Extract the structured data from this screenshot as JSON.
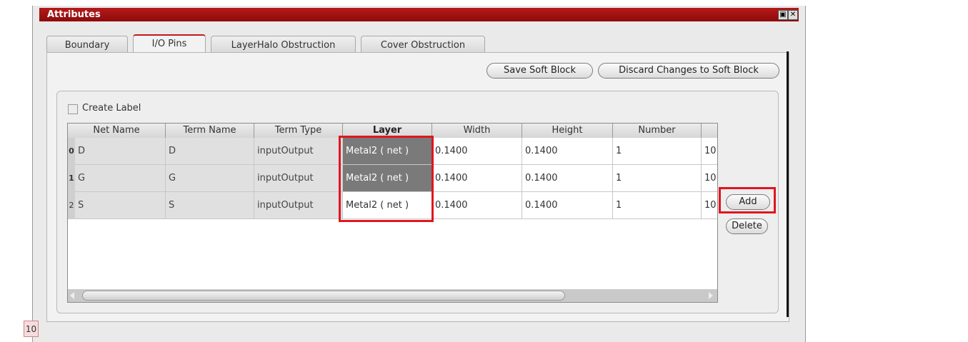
{
  "window": {
    "title": "Attributes",
    "restore_icon": "restore-icon",
    "close_icon": "close-icon"
  },
  "tabs": [
    {
      "label": "Boundary",
      "active": false
    },
    {
      "label": "I/O Pins",
      "active": true
    },
    {
      "label": "LayerHalo Obstruction",
      "active": false
    },
    {
      "label": "Cover Obstruction",
      "active": false
    }
  ],
  "actions": {
    "save": "Save Soft Block",
    "discard": "Discard Changes to Soft Block"
  },
  "create_label": {
    "label": "Create Label",
    "checked": false
  },
  "table": {
    "columns": [
      "Net Name",
      "Term Name",
      "Term Type",
      "Layer",
      "Width",
      "Height",
      "Number",
      ""
    ],
    "rows": [
      {
        "index": "0",
        "net": "D",
        "term": "D",
        "type": "inputOutput",
        "layer": "Metal2 ( net )",
        "width": "0.1400",
        "height": "0.1400",
        "number": "1",
        "extra": "10"
      },
      {
        "index": "1",
        "net": "G",
        "term": "G",
        "type": "inputOutput",
        "layer": "Metal2 ( net )",
        "width": "0.1400",
        "height": "0.1400",
        "number": "1",
        "extra": "10"
      },
      {
        "index": "2",
        "net": "S",
        "term": "S",
        "type": "inputOutput",
        "layer": "Metal2 ( net )",
        "width": "0.1400",
        "height": "0.1400",
        "number": "1",
        "extra": "10"
      }
    ]
  },
  "side_buttons": {
    "add": "Add",
    "delete": "Delete"
  },
  "status": {
    "badge": "10"
  },
  "colors": {
    "accent": "#b41a1a",
    "highlight": "#e0161e"
  }
}
